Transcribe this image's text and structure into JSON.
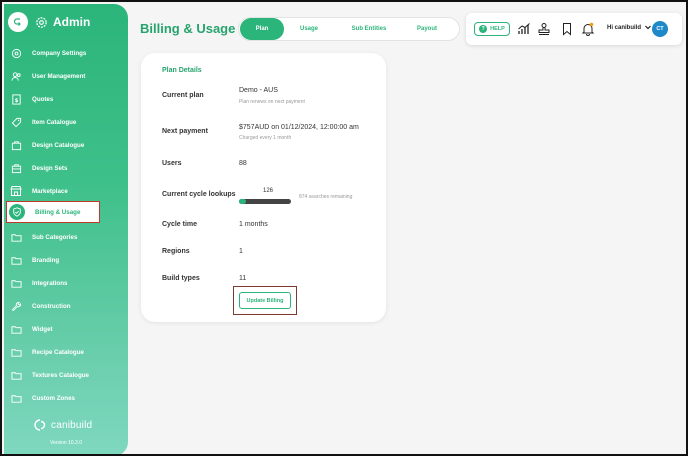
{
  "sidebar": {
    "title": "Admin",
    "items": [
      {
        "label": "Company Settings",
        "icon": "settings-icon"
      },
      {
        "label": "User Management",
        "icon": "users-icon"
      },
      {
        "label": "Quotes",
        "icon": "quote-icon"
      },
      {
        "label": "Item Catalogue",
        "icon": "tag-icon"
      },
      {
        "label": "Design Catalogue",
        "icon": "briefcase-icon"
      },
      {
        "label": "Design Sets",
        "icon": "briefcase-icon"
      },
      {
        "label": "Marketplace",
        "icon": "store-icon"
      },
      {
        "label": "Billing & Usage",
        "icon": "shield-check-icon",
        "active": true
      },
      {
        "label": "Sub Categories",
        "icon": "folder-icon"
      },
      {
        "label": "Branding",
        "icon": "folder-icon"
      },
      {
        "label": "Integrations",
        "icon": "folder-icon"
      },
      {
        "label": "Construction",
        "icon": "wrench-icon"
      },
      {
        "label": "Widget",
        "icon": "folder-icon"
      },
      {
        "label": "Recipe Catalogue",
        "icon": "folder-icon"
      },
      {
        "label": "Textures Catalogue",
        "icon": "folder-icon"
      },
      {
        "label": "Custom Zones",
        "icon": "folder-icon"
      }
    ],
    "logo_text": "canibuild",
    "version": "Version 10.3.0"
  },
  "header": {
    "title": "Billing & Usage",
    "tabs": [
      {
        "label": "Plan",
        "active": true
      },
      {
        "label": "Usage"
      },
      {
        "label": "Sub Entities"
      },
      {
        "label": "Payout"
      }
    ],
    "help_label": "HELP",
    "user_name": "Hi canibuild",
    "avatar_initials": "CT"
  },
  "plan": {
    "section_title": "Plan Details",
    "rows": {
      "current_plan": {
        "label": "Current plan",
        "value": "Demo - AUS",
        "sub": "Plan renews on next payment"
      },
      "next_payment": {
        "label": "Next payment",
        "value": "$757AUD on 01/12/2024, 12:00:00 am",
        "sub": "Charged every 1 month"
      },
      "users": {
        "label": "Users",
        "value": "88"
      },
      "lookups": {
        "label": "Current cycle lookups",
        "value": "126",
        "remaining": "874 searches remaining",
        "progress": 0.126
      },
      "cycle_time": {
        "label": "Cycle time",
        "value": "1 months"
      },
      "regions": {
        "label": "Regions",
        "value": "1"
      },
      "build_types": {
        "label": "Build types",
        "value": "11"
      }
    },
    "update_button": "Update Billing"
  },
  "colors": {
    "brand_green": "#2bb57a",
    "highlight_red": "#c0392b",
    "avatar_blue": "#1e88c8"
  }
}
